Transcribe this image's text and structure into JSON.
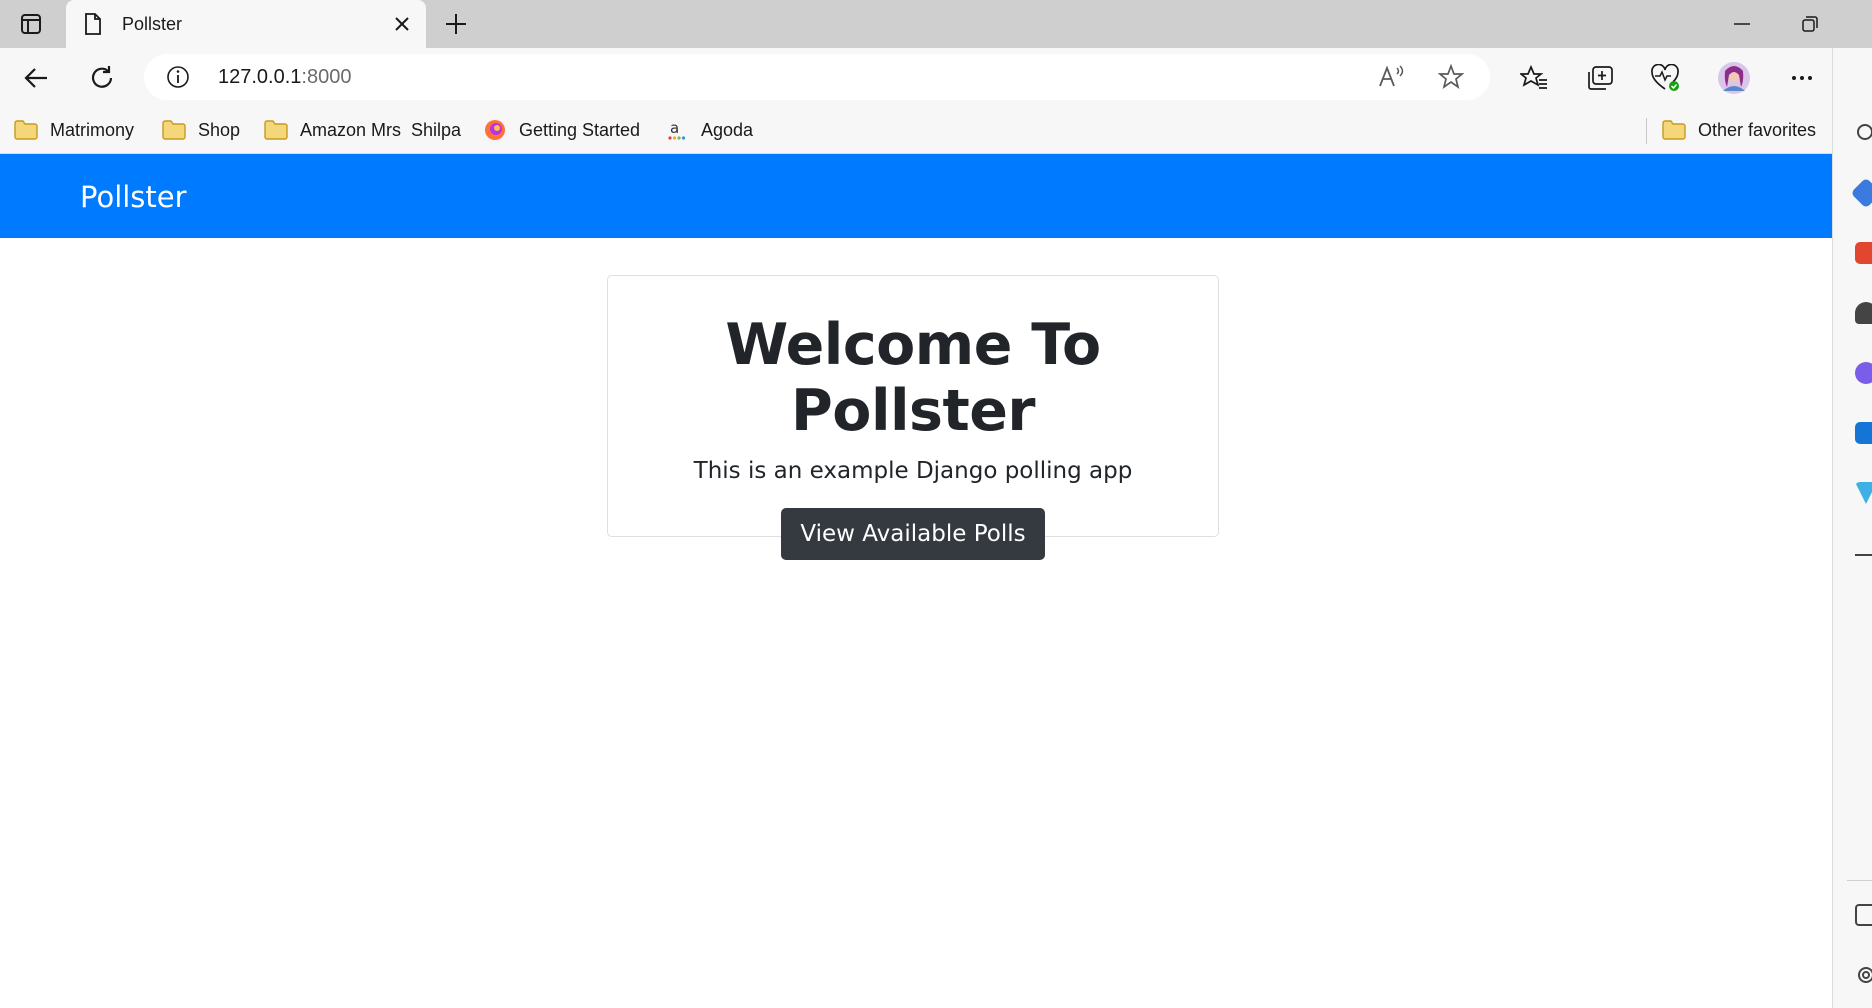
{
  "browser": {
    "tab": {
      "title": "Pollster",
      "icon": "page-icon"
    },
    "address": {
      "host": "127.0.0.1",
      "port": ":8000"
    },
    "favorites": [
      {
        "label": "Matrimony",
        "icon": "folder-icon"
      },
      {
        "label": "Shop",
        "icon": "folder-icon"
      },
      {
        "label": "Amazon Mrs  Shilpa",
        "icon": "folder-icon"
      },
      {
        "label": "Getting Started",
        "icon": "firefox-icon"
      },
      {
        "label": "Agoda",
        "icon": "agoda-icon"
      }
    ],
    "other_favorites": {
      "label": "Other favorites",
      "icon": "folder-icon"
    }
  },
  "site": {
    "brand": "Pollster",
    "heading": "Welcome To Pollster",
    "subtitle": "This is an example Django polling app",
    "cta": "View Available Polls"
  },
  "colors": {
    "navbar": "#007bff",
    "button": "#343a40",
    "text": "#212529"
  }
}
